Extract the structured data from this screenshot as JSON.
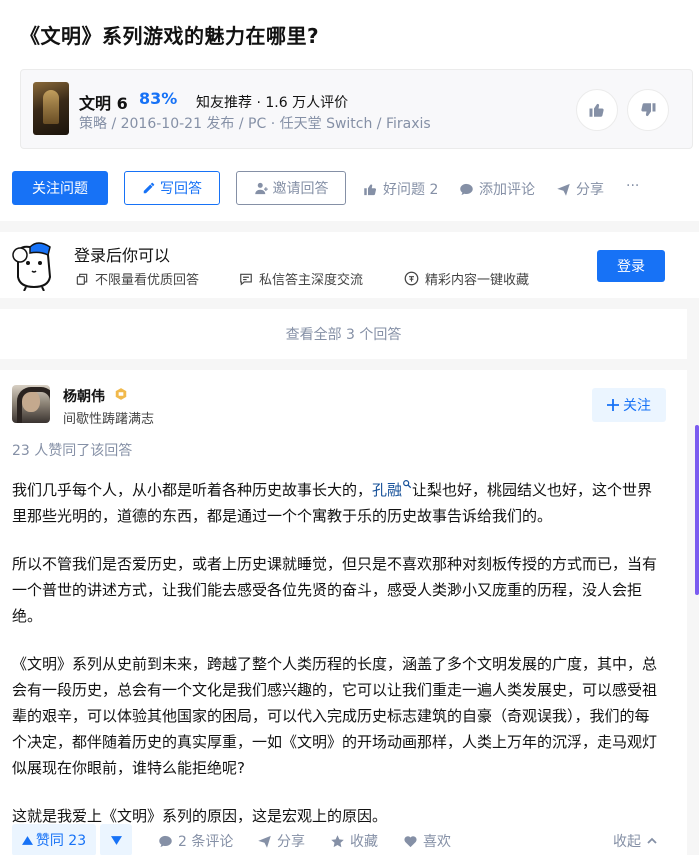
{
  "question": {
    "title": "《文明》系列游戏的魅力在哪里?"
  },
  "game": {
    "name": "文明 6",
    "rating": "83%",
    "rec_text": "知友推荐 · 1.6 万人评价",
    "meta": "策略 / 2016-10-21 发布 / PC · 任天堂 Switch / Firaxis"
  },
  "actions": {
    "follow": "关注问题",
    "write": "写回答",
    "invite": "邀请回答",
    "good_q": "好问题 2",
    "comment": "添加评论",
    "share": "分享",
    "more": "···"
  },
  "login": {
    "title": "登录后你可以",
    "feat1": "不限量看优质回答",
    "feat2": "私信答主深度交流",
    "feat3": "精彩内容一键收藏",
    "button": "登录"
  },
  "view_all": "查看全部 3 个回答",
  "answer": {
    "author": "杨朝伟",
    "bio": "间歇性踌躇满志",
    "follow": "关注",
    "vote_text": "23 人赞同了该回答",
    "p1_a": "我们几乎每个人，从小都是听着各种历史故事长大的，",
    "p1_link": "孔融",
    "p1_b": "让梨也好，桃园结义也好，这个世界里那些光明的，道德的东西，都是通过一个个寓教于乐的历史故事告诉给我们的。",
    "p2": "所以不管我们是否爱历史，或者上历史课就睡觉，但只是不喜欢那种对刻板传授的方式而已，当有一个普世的讲述方式，让我们能去感受各位先贤的奋斗，感受人类渺小又庞重的历程，没人会拒绝。",
    "p3": "《文明》系列从史前到未来，跨越了整个人类历程的长度，涵盖了多个文明发展的广度，其中，总会有一段历史，总会有一个文化是我们感兴趣的，它可以让我们重走一遍人类发展史，可以感受祖辈的艰辛，可以体验其他国家的困局，可以代入完成历史标志建筑的自豪（奇观误我），我们的每个决定，都伴随着历史的真实厚重，一如《文明》的开场动画那样，人类上万年的沉浮，走马观灯似展现在你眼前，谁特么能拒绝呢?",
    "p4": "这就是我爱上《文明》系列的原因，这是宏观上的原因。"
  },
  "bottom": {
    "upvote": "赞同 23",
    "comments": "2 条评论",
    "share": "分享",
    "collect": "收藏",
    "like": "喜欢",
    "collapse": "收起"
  }
}
